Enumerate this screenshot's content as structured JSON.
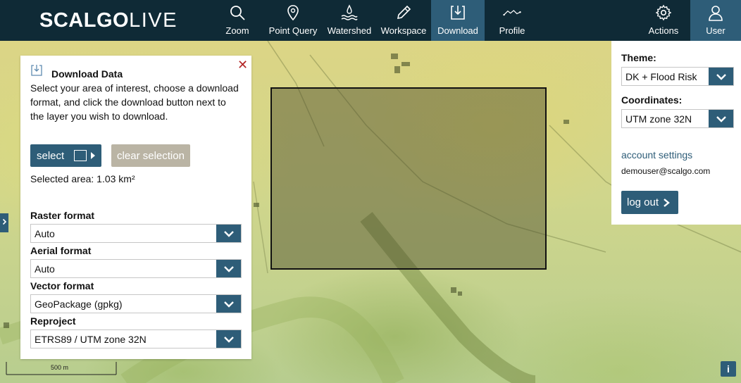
{
  "app": {
    "logo_bold": "SCALGO",
    "logo_thin": "LIVE",
    "accent_color": "#2e5d78",
    "topbar_color": "#0f2a36"
  },
  "nav": {
    "items": [
      {
        "label": "Zoom",
        "icon": "zoom-icon"
      },
      {
        "label": "Point Query",
        "icon": "pin-icon"
      },
      {
        "label": "Watershed",
        "icon": "watershed-icon"
      },
      {
        "label": "Workspace",
        "icon": "pencil-icon"
      },
      {
        "label": "Download",
        "icon": "download-icon",
        "active": true
      },
      {
        "label": "Profile",
        "icon": "profile-icon"
      }
    ],
    "actions_label": "Actions",
    "user_label": "User"
  },
  "download_panel": {
    "title": "Download Data",
    "description": "Select your area of interest, choose a download format, and click the download button next to the layer you wish to download.",
    "select_label": "select",
    "clear_label": "clear selection",
    "selected_area": "Selected area: 1.03 km²",
    "raster_label": "Raster format",
    "raster_value": "Auto",
    "aerial_label": "Aerial format",
    "aerial_value": "Auto",
    "vector_label": "Vector format",
    "vector_value": "GeoPackage (gpkg)",
    "reproject_label": "Reproject",
    "reproject_value": "ETRS89 / UTM zone 32N"
  },
  "settings_panel": {
    "theme_label": "Theme:",
    "theme_value": "DK + Flood Risk",
    "coords_label": "Coordinates:",
    "coords_value": "UTM zone 32N",
    "account_link": "account settings",
    "email": "demouser@scalgo.com",
    "logout_label": "log out"
  },
  "map": {
    "scale_label": "500 m",
    "info_label": "i"
  }
}
